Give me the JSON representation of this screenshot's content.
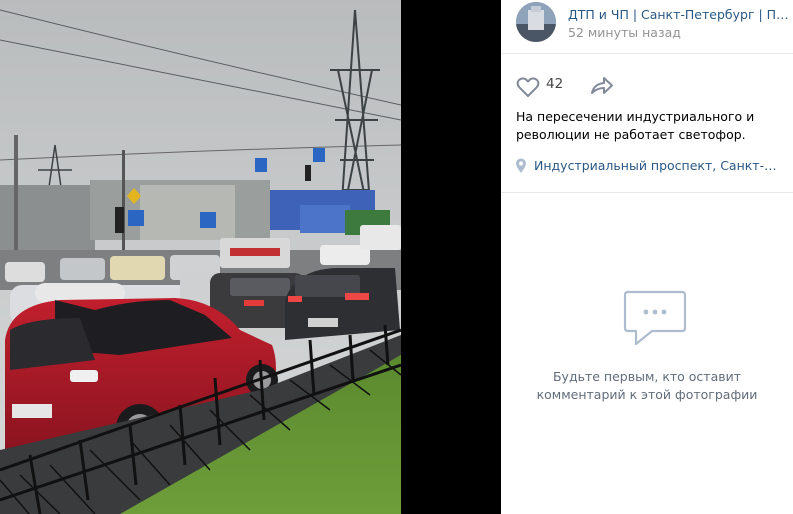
{
  "post": {
    "author": "ДТП и ЧП | Санкт-Петербург | Питер Онлайн | СПб",
    "time": "52 минуты назад",
    "likes": "42",
    "caption": "На пересечении индустриального и революции не работает светофор.",
    "location": "Индустриальный проспект, Санкт-Петербург"
  },
  "comments": {
    "empty_line1": "Будьте первым, кто оставит",
    "empty_line2": "комментарий к этой фотографии"
  },
  "photo": {
    "plate_left": "",
    "plate_right": ""
  },
  "icons": {
    "like": "heart-icon",
    "share": "share-arrow-icon",
    "location": "location-pin-icon",
    "empty_comments": "speech-bubble-icon"
  },
  "colors": {
    "link": "#2a5885",
    "muted": "#939393",
    "icon": "#828a99",
    "empty_icon": "#aebccf"
  }
}
